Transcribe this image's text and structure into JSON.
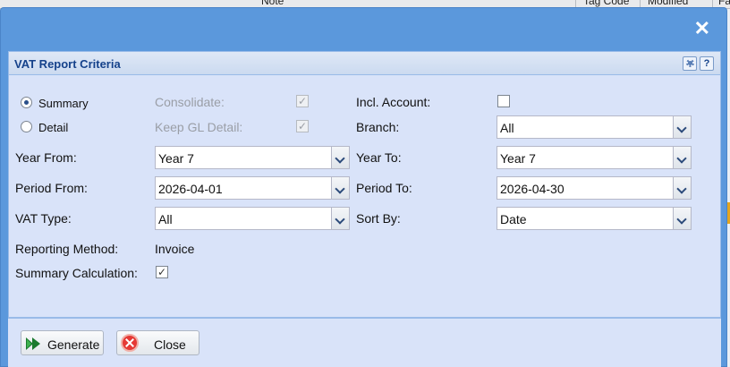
{
  "background": {
    "columns": [
      "Note",
      "Tag Code",
      "Modified",
      "Fa"
    ]
  },
  "window": {
    "close_icon": "close-icon",
    "panel_title": "VAT Report Criteria",
    "tools": {
      "gear": "gear-icon",
      "help": "?"
    }
  },
  "form": {
    "mode_options": [
      {
        "label": "Summary",
        "selected": true
      },
      {
        "label": "Detail",
        "selected": false
      }
    ],
    "consolidate": {
      "label": "Consolidate:",
      "checked": true,
      "disabled": true
    },
    "keep_gl_detail": {
      "label": "Keep GL Detail:",
      "checked": true,
      "disabled": true
    },
    "incl_account": {
      "label": "Incl. Account:",
      "checked": false
    },
    "branch": {
      "label": "Branch:",
      "value": "All"
    },
    "year_from": {
      "label": "Year From:",
      "value": "Year 7"
    },
    "year_to": {
      "label": "Year To:",
      "value": "Year 7"
    },
    "period_from": {
      "label": "Period From:",
      "value": "2026-04-01"
    },
    "period_to": {
      "label": "Period To:",
      "value": "2026-04-30"
    },
    "vat_type": {
      "label": "VAT Type:",
      "value": "All"
    },
    "sort_by": {
      "label": "Sort By:",
      "value": "Date"
    },
    "reporting_method": {
      "label": "Reporting Method:",
      "value": "Invoice"
    },
    "summary_calculation": {
      "label": "Summary Calculation:",
      "checked": true
    }
  },
  "footer": {
    "generate_label": "Generate",
    "close_label": "Close"
  },
  "check_glyph": "✓"
}
